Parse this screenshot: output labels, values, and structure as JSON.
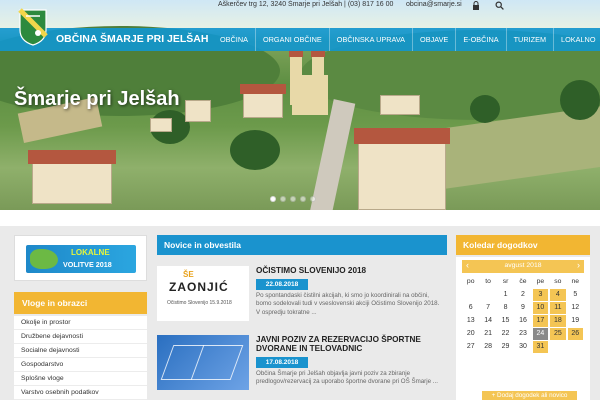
{
  "topbar": {
    "contact": "Aškerčev trg 12, 3240 Šmarje pri Jelšah  |  (03) 817 16 00",
    "email": "obcina@smarje.si"
  },
  "header": {
    "site_title": "OBČINA ŠMARJE PRI JELŠAH"
  },
  "nav": {
    "items": [
      {
        "label": "OBČINA"
      },
      {
        "label": "ORGANI OBČINE"
      },
      {
        "label": "OBČINSKA UPRAVA"
      },
      {
        "label": "OBJAVE"
      },
      {
        "label": "E-OBČINA"
      },
      {
        "label": "TURIZEM"
      },
      {
        "label": "LOKALNO"
      }
    ]
  },
  "hero": {
    "title": "Šmarje pri Jelšah",
    "slides": 5,
    "active_slide": 1
  },
  "banner": {
    "line1": "LOKALNE",
    "line2": "VOLITVE 2018"
  },
  "vloge": {
    "title": "Vloge in obrazci",
    "items": [
      {
        "label": "Okolje in prostor"
      },
      {
        "label": "Družbene dejavnosti"
      },
      {
        "label": "Socialne dejavnosti"
      },
      {
        "label": "Gospodarstvo"
      },
      {
        "label": "Splošne vloge"
      },
      {
        "label": "Varstvo osebnih podatkov"
      }
    ]
  },
  "news": {
    "title": "Novice in obvestila",
    "items": [
      {
        "title": "OČISTIMO SLOVENIJO 2018",
        "date": "22.08.2018",
        "text": "Po spontandaski čistilni akcijah, ki smo jo koordinirali na občini, bomo sodelovali tudi v vseslovenski akciji Očistimo Slovenijo 2018. V ospredju tokratne ...",
        "thumb": {
          "top": "ŠE",
          "mid": "ZAONJIĆ",
          "bottom": "Očistimo Slovenijo 15.9.2018"
        }
      },
      {
        "title": "JAVNI POZIV ZA REZERVACIJO ŠPORTNE DVORANE IN TELOVADNIC",
        "title_line1": "JAVNI POZIV ZA REZERVACIJO ŠPORTNE",
        "title_line2": "DVORANE IN TELOVADNIC",
        "date": "17.08.2018",
        "text": "Občina Šmarje pri Jelšah objavlja javni poziv za zbiranje predlogov/rezervacij za uporabo športne dvorane pri OŠ Šmarje ..."
      }
    ]
  },
  "calendar": {
    "title": "Koledar dogodkov",
    "month": "avgust 2018",
    "prev": "‹",
    "next": "›",
    "dows": [
      "po",
      "to",
      "sr",
      "če",
      "pe",
      "so",
      "ne"
    ],
    "weeks": [
      [
        "",
        "",
        "1",
        "2",
        "3",
        "4",
        "5"
      ],
      [
        "6",
        "7",
        "8",
        "9",
        "10",
        "11",
        "12"
      ],
      [
        "13",
        "14",
        "15",
        "16",
        "17",
        "18",
        "19"
      ],
      [
        "20",
        "21",
        "22",
        "23",
        "24",
        "25",
        "26"
      ],
      [
        "27",
        "28",
        "29",
        "30",
        "31",
        "",
        ""
      ]
    ],
    "event_days": [
      "3",
      "4",
      "10",
      "11",
      "17",
      "18",
      "24",
      "25",
      "26",
      "31"
    ],
    "today": "24",
    "add_label": "+ Dodaj dogodek ali novico"
  }
}
